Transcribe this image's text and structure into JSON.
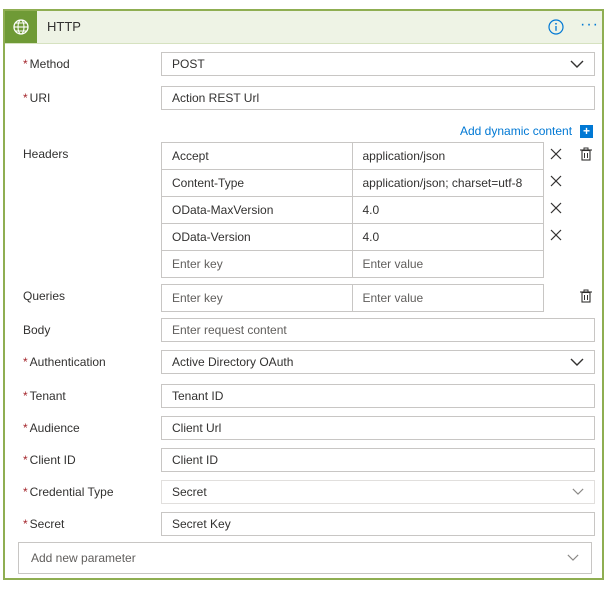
{
  "header": {
    "title": "HTTP",
    "accent_color": "#6f9a36",
    "icons": {
      "logo": "globe-icon",
      "info": "info-icon",
      "more": "more-icon"
    }
  },
  "fields": {
    "method": {
      "label": "Method",
      "required": true,
      "value": "POST",
      "type": "select"
    },
    "uri": {
      "label": "URI",
      "required": true,
      "value": "Action REST Url"
    },
    "add_dynamic_content": "Add dynamic content",
    "headers": {
      "label": "Headers",
      "rows": [
        {
          "key": "Accept",
          "value": "application/json"
        },
        {
          "key": "Content-Type",
          "value": "application/json; charset=utf-8"
        },
        {
          "key": "OData-MaxVersion",
          "value": "4.0"
        },
        {
          "key": "OData-Version",
          "value": "4.0"
        }
      ],
      "key_placeholder": "Enter key",
      "value_placeholder": "Enter value"
    },
    "queries": {
      "label": "Queries",
      "key_placeholder": "Enter key",
      "value_placeholder": "Enter value"
    },
    "body": {
      "label": "Body",
      "placeholder": "Enter request content"
    },
    "authentication": {
      "label": "Authentication",
      "required": true,
      "value": "Active Directory OAuth",
      "type": "select"
    },
    "tenant": {
      "label": "Tenant",
      "required": true,
      "value": "Tenant ID"
    },
    "audience": {
      "label": "Audience",
      "required": true,
      "value": "Client Url"
    },
    "client_id": {
      "label": "Client ID",
      "required": true,
      "value": "Client ID"
    },
    "credential_type": {
      "label": "Credential Type",
      "required": true,
      "value": "Secret",
      "type": "select"
    },
    "secret": {
      "label": "Secret",
      "required": true,
      "value": "Secret Key"
    },
    "add_new_parameter": "Add new parameter"
  }
}
